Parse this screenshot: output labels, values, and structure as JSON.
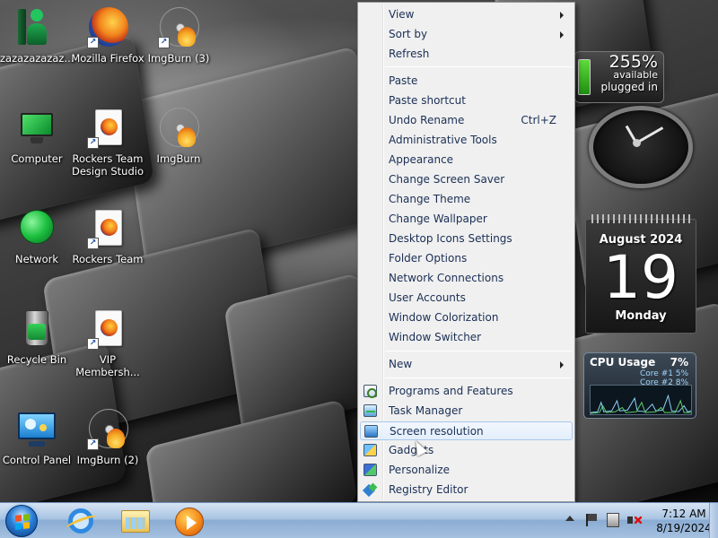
{
  "desktop": {
    "icons": [
      {
        "label": "zazazazazaz...",
        "icon": "user-icon"
      },
      {
        "label": "Mozilla Firefox",
        "icon": "firefox-icon"
      },
      {
        "label": "ImgBurn (3)",
        "icon": "imgburn-icon"
      },
      {
        "label": "Computer",
        "icon": "computer-icon"
      },
      {
        "label": "Rockers Team Design Studio",
        "icon": "firefox-shortcut-icon"
      },
      {
        "label": "ImgBurn",
        "icon": "imgburn-icon"
      },
      {
        "label": "Network",
        "icon": "network-icon"
      },
      {
        "label": "Rockers Team",
        "icon": "firefox-shortcut-icon"
      },
      {
        "label": "Recycle Bin",
        "icon": "recycle-bin-icon"
      },
      {
        "label": "VIP Membersh...",
        "icon": "firefox-shortcut-icon"
      },
      {
        "label": "Control Panel",
        "icon": "control-panel-icon"
      },
      {
        "label": "ImgBurn (2)",
        "icon": "imgburn-icon"
      }
    ]
  },
  "context_menu": {
    "items": [
      {
        "label": "View",
        "has_submenu": true
      },
      {
        "label": "Sort by",
        "has_submenu": true
      },
      {
        "label": "Refresh"
      },
      {
        "label": "Paste"
      },
      {
        "label": "Paste shortcut"
      },
      {
        "label": "Undo Rename",
        "shortcut": "Ctrl+Z"
      },
      {
        "label": "Administrative Tools"
      },
      {
        "label": "Appearance"
      },
      {
        "label": "Change Screen Saver"
      },
      {
        "label": "Change Theme"
      },
      {
        "label": "Change Wallpaper"
      },
      {
        "label": "Desktop Icons Settings"
      },
      {
        "label": "Folder Options"
      },
      {
        "label": "Network Connections"
      },
      {
        "label": "User Accounts"
      },
      {
        "label": "Window Colorization"
      },
      {
        "label": "Window Switcher"
      },
      {
        "label": "New",
        "has_submenu": true
      },
      {
        "label": "Programs and Features",
        "icon": "programs-features-icon"
      },
      {
        "label": "Task Manager",
        "icon": "task-manager-icon"
      },
      {
        "label": "Screen resolution",
        "icon": "screen-resolution-icon",
        "highlighted": true
      },
      {
        "label": "Gadgets",
        "icon": "gadgets-icon"
      },
      {
        "label": "Personalize",
        "icon": "personalize-icon"
      },
      {
        "label": "Registry Editor",
        "icon": "registry-editor-icon"
      }
    ]
  },
  "gadgets": {
    "battery": {
      "percent": "255%",
      "status": "available",
      "power": "plugged in"
    },
    "calendar": {
      "month_year": "August 2024",
      "day": "19",
      "weekday": "Monday"
    },
    "cpu": {
      "title": "CPU Usage",
      "total": "7%",
      "cores": [
        {
          "label": "Core #1",
          "value": "5%"
        },
        {
          "label": "Core #2",
          "value": "8%"
        }
      ]
    }
  },
  "taskbar": {
    "pinned": [
      "internet-explorer-icon",
      "windows-explorer-icon",
      "media-player-icon"
    ],
    "clock": {
      "time": "7:12 AM",
      "date": "8/19/2024"
    }
  },
  "colors": {
    "menu_text": "#1a2f55",
    "highlight_border": "#a8c8ea",
    "taskbar": "#a9c4e2"
  }
}
